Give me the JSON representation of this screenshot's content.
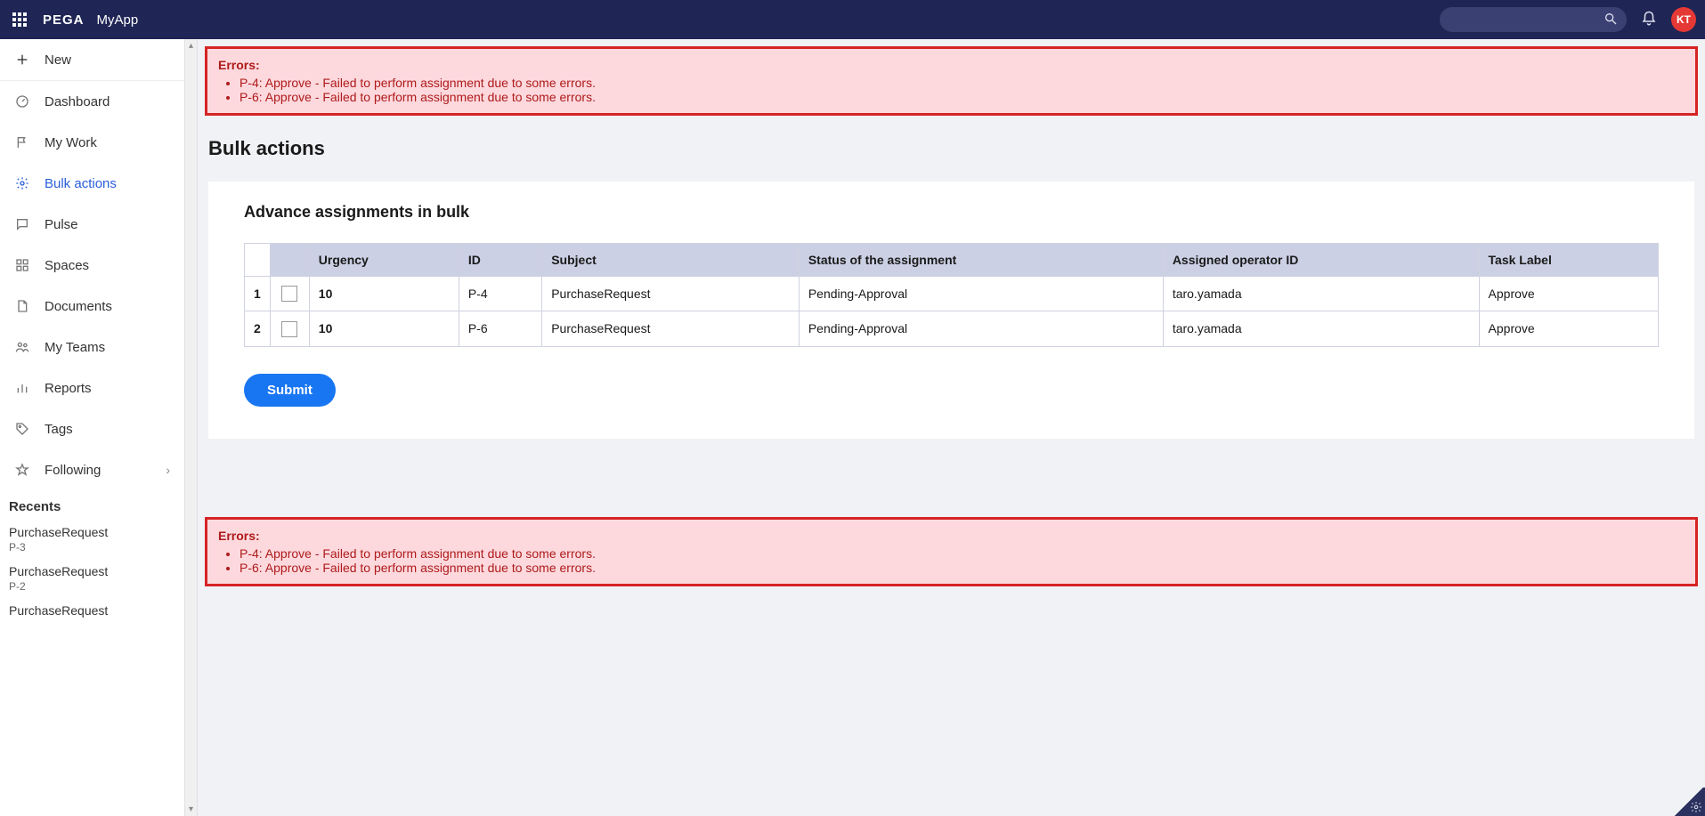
{
  "header": {
    "brand": "PEGA",
    "appName": "MyApp",
    "avatarInitials": "KT",
    "searchPlaceholder": ""
  },
  "sidebar": {
    "new": "New",
    "items": [
      {
        "id": "dashboard",
        "label": "Dashboard",
        "icon": "gauge"
      },
      {
        "id": "my-work",
        "label": "My Work",
        "icon": "flag"
      },
      {
        "id": "bulk-actions",
        "label": "Bulk actions",
        "icon": "gear",
        "active": true
      },
      {
        "id": "pulse",
        "label": "Pulse",
        "icon": "chat"
      },
      {
        "id": "spaces",
        "label": "Spaces",
        "icon": "grid"
      },
      {
        "id": "documents",
        "label": "Documents",
        "icon": "doc"
      },
      {
        "id": "my-teams",
        "label": "My Teams",
        "icon": "people"
      },
      {
        "id": "reports",
        "label": "Reports",
        "icon": "bars"
      },
      {
        "id": "tags",
        "label": "Tags",
        "icon": "tag"
      },
      {
        "id": "following",
        "label": "Following",
        "icon": "star",
        "chevron": true
      }
    ],
    "recentsHeader": "Recents",
    "recents": [
      {
        "title": "PurchaseRequest",
        "sub": "P-3"
      },
      {
        "title": "PurchaseRequest",
        "sub": "P-2"
      },
      {
        "title": "PurchaseRequest",
        "sub": ""
      }
    ]
  },
  "errors": {
    "title": "Errors:",
    "items": [
      "P-4: Approve - Failed to perform assignment due to some errors.",
      "P-6: Approve - Failed to perform assignment due to some errors."
    ]
  },
  "page": {
    "title": "Bulk actions",
    "cardTitle": "Advance assignments in bulk",
    "submitLabel": "Submit",
    "columns": [
      "",
      "",
      "Urgency",
      "ID",
      "Subject",
      "Status of the assignment",
      "Assigned operator ID",
      "Task Label"
    ],
    "rows": [
      {
        "num": "1",
        "urgency": "10",
        "id": "P-4",
        "subject": "PurchaseRequest",
        "status": "Pending-Approval",
        "operator": "taro.yamada",
        "task": "Approve"
      },
      {
        "num": "2",
        "urgency": "10",
        "id": "P-6",
        "subject": "PurchaseRequest",
        "status": "Pending-Approval",
        "operator": "taro.yamada",
        "task": "Approve"
      }
    ]
  }
}
